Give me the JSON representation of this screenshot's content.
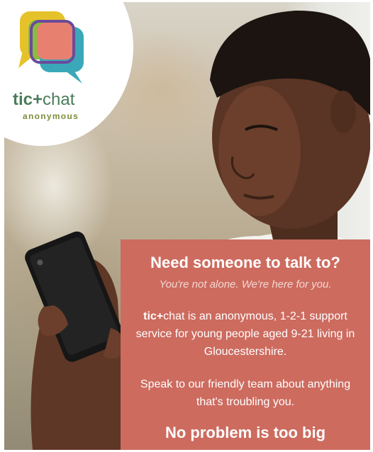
{
  "brand": {
    "logo_name_bold": "tic+",
    "logo_name_rest": "chat",
    "logo_tagline": "anonymous",
    "colors": {
      "green": "#4a7d5a",
      "olive": "#7a8e3a",
      "yellow": "#e6c22a",
      "lime": "#8bbb3f",
      "teal": "#3aa8b8",
      "coral": "#e88070",
      "purple": "#6b4a9b"
    }
  },
  "panel": {
    "headline": "Need someone to talk to?",
    "subline": "You're not alone. We're here for you.",
    "para1_brand_bold": "tic+",
    "para1_rest": "chat is an anonymous, 1-2-1 support service for young people aged 9-21 living in Gloucestershire.",
    "para2": "Speak to our friendly team about anything that's troubling you.",
    "footer": "No problem is too big",
    "background_color": "#cd6b5f"
  },
  "photo": {
    "subject": "young-man-looking-at-phone-icon"
  }
}
